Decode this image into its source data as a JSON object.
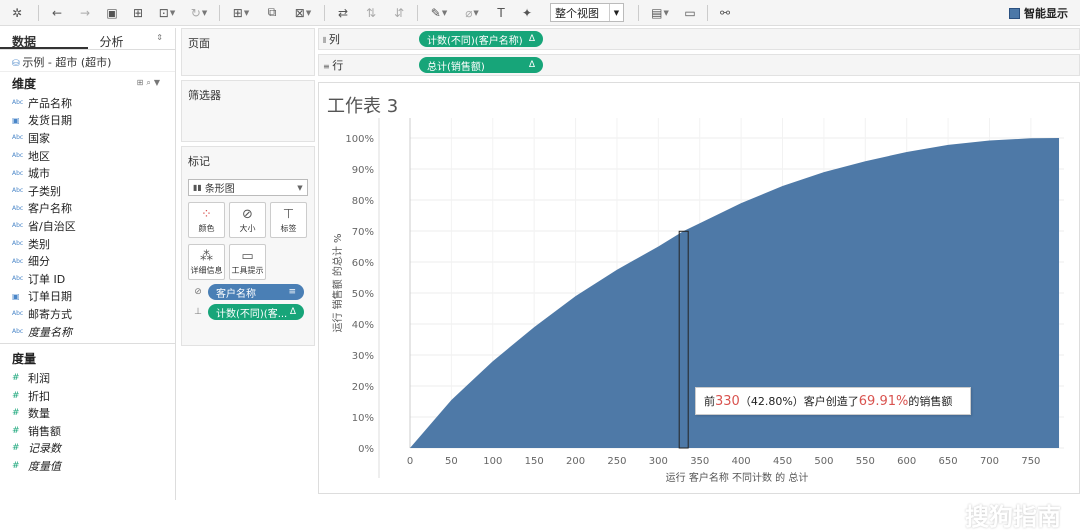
{
  "toolbar": {
    "view_mode": "整个视图",
    "smart_show": "智能显示"
  },
  "left": {
    "tab_data": "数据",
    "tab_analysis": "分析",
    "datasource": "示例 - 超市 (超市)",
    "dimensions_title": "维度",
    "dimensions": [
      {
        "label": "产品名称",
        "type": "abc"
      },
      {
        "label": "发货日期",
        "type": "date"
      },
      {
        "label": "国家",
        "type": "abc"
      },
      {
        "label": "地区",
        "type": "abc"
      },
      {
        "label": "城市",
        "type": "abc"
      },
      {
        "label": "子类别",
        "type": "abc"
      },
      {
        "label": "客户名称",
        "type": "abc"
      },
      {
        "label": "省/自治区",
        "type": "abc"
      },
      {
        "label": "类别",
        "type": "abc"
      },
      {
        "label": "细分",
        "type": "abc"
      },
      {
        "label": "订单 ID",
        "type": "abc"
      },
      {
        "label": "订单日期",
        "type": "date"
      },
      {
        "label": "邮寄方式",
        "type": "abc"
      },
      {
        "label": "度量名称",
        "type": "abc",
        "italic": true
      }
    ],
    "measures_title": "度量",
    "measures": [
      {
        "label": "利润"
      },
      {
        "label": "折扣"
      },
      {
        "label": "数量"
      },
      {
        "label": "销售额"
      },
      {
        "label": "记录数",
        "italic": true
      },
      {
        "label": "度量值",
        "italic": true
      }
    ]
  },
  "cards": {
    "pages": "页面",
    "filters": "筛选器",
    "marks": "标记",
    "mark_type": "条形图",
    "buttons": {
      "color": "颜色",
      "size": "大小",
      "label": "标签",
      "detail": "详细信息",
      "tooltip": "工具提示"
    },
    "pill_customer": "客户名称",
    "pill_count": "计数(不同)(客..."
  },
  "shelves": {
    "columns_label": "列",
    "columns_pill": "计数(不同)(客户名称)",
    "rows_label": "行",
    "rows_pill": "总计(销售额)",
    "delta": "Δ"
  },
  "viz": {
    "title": "工作表 3",
    "tooltip": {
      "pre": "前",
      "n": "330",
      "pct": "（42.80%）客户创造了",
      "share": "69.91%",
      "post": "的销售额"
    }
  },
  "chart_data": {
    "type": "area",
    "xlabel": "运行 客户名称 不同计数 的 总计",
    "ylabel": "运行 销售额 的总计 %",
    "xlim": [
      0,
      790
    ],
    "ylim": [
      0,
      1
    ],
    "x_ticks": [
      "0",
      "50",
      "100",
      "150",
      "200",
      "250",
      "300",
      "350",
      "400",
      "450",
      "500",
      "550",
      "600",
      "650",
      "700",
      "750"
    ],
    "y_ticks": [
      "0%",
      "10%",
      "20%",
      "30%",
      "40%",
      "50%",
      "60%",
      "70%",
      "80%",
      "90%",
      "100%"
    ],
    "x": [
      0,
      50,
      100,
      150,
      200,
      250,
      300,
      330,
      350,
      400,
      450,
      500,
      550,
      600,
      650,
      700,
      750,
      784
    ],
    "y": [
      0,
      0.155,
      0.28,
      0.39,
      0.49,
      0.575,
      0.65,
      0.699,
      0.725,
      0.79,
      0.845,
      0.89,
      0.925,
      0.955,
      0.978,
      0.992,
      0.999,
      1.0
    ],
    "highlight_x": 330,
    "highlight_y": 0.6991,
    "color": "#4e79a7",
    "grid": true
  },
  "watermark": "搜狗指南"
}
